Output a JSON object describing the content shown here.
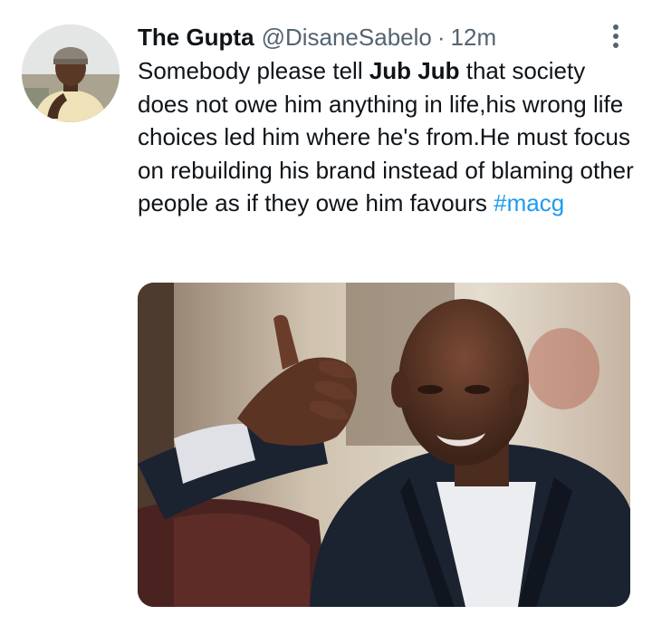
{
  "tweet": {
    "author": {
      "display_name": "The Gupta",
      "handle": "@DisaneSabelo"
    },
    "separator": "·",
    "timestamp": "12m",
    "text": {
      "part1": "Somebody please tell ",
      "bold": "Jub Jub",
      "part2": " that society does not owe him anything in life,his wrong life choices led him where he's from.He must focus on rebuilding his brand instead of blaming other people as if they owe him favours ",
      "hashtag": "#macg"
    },
    "more_icon": "more-vertical-icon",
    "avatar_icon": "user-avatar",
    "media_icon": "photo-man-pointing"
  },
  "colors": {
    "text": "#0f1419",
    "secondary": "#536471",
    "hashtag": "#1d9bf0",
    "background": "#ffffff"
  }
}
